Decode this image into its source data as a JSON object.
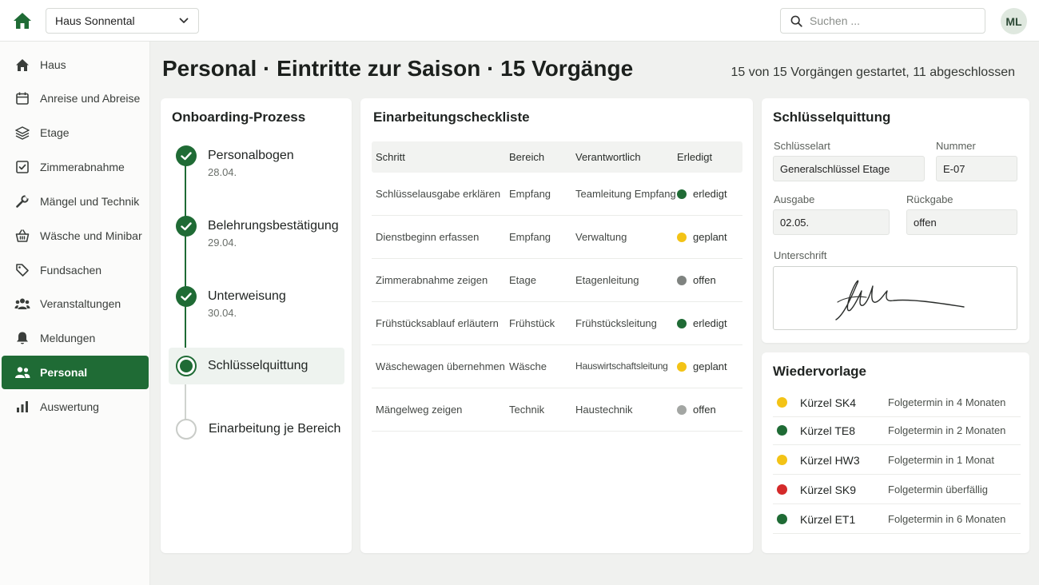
{
  "topbar": {
    "house": "Haus Sonnental",
    "search_placeholder": "Suchen ...",
    "avatar": "ML"
  },
  "sidebar": {
    "items": [
      {
        "label": "Haus",
        "icon": "home-icon"
      },
      {
        "label": "Anreise und Abreise",
        "icon": "calendar-icon"
      },
      {
        "label": "Etage",
        "icon": "layers-icon"
      },
      {
        "label": "Zimmerabnahme",
        "icon": "checkbox-icon"
      },
      {
        "label": "Mängel und Technik",
        "icon": "wrench-icon"
      },
      {
        "label": "Wäsche und Minibar",
        "icon": "basket-icon"
      },
      {
        "label": "Fundsachen",
        "icon": "tag-icon"
      },
      {
        "label": "Veranstaltungen",
        "icon": "group-icon"
      },
      {
        "label": "Meldungen",
        "icon": "bell-icon"
      },
      {
        "label": "Personal",
        "icon": "people-icon",
        "active": true
      },
      {
        "label": "Auswertung",
        "icon": "bar-chart-icon"
      }
    ]
  },
  "header": {
    "title": "Personal · Eintritte zur Saison · 15 Vorgänge",
    "summary": "15 von 15 Vorgängen gestartet, 11 abgeschlossen"
  },
  "onboarding": {
    "title": "Onboarding-Prozess",
    "steps": [
      {
        "label": "Personalbogen",
        "date": "28.04.",
        "state": "done"
      },
      {
        "label": "Belehrungsbestätigung",
        "date": "29.04.",
        "state": "done"
      },
      {
        "label": "Unterweisung",
        "date": "30.04.",
        "state": "done"
      },
      {
        "label": "Schlüsselquittung",
        "date": "",
        "state": "current"
      },
      {
        "label": "Einarbeitung je Bereich",
        "date": "",
        "state": "todo"
      }
    ]
  },
  "checklist": {
    "title": "Einarbeitungscheckliste",
    "columns": [
      "Schritt",
      "Bereich",
      "Verantwortlich",
      "Erledigt"
    ],
    "rows": [
      {
        "step": "Schlüsselausgabe erklären",
        "area": "Empfang",
        "responsible": "Teamleitung Empfang",
        "status": "erledigt",
        "color": "#1f6b35"
      },
      {
        "step": "Dienstbeginn erfassen",
        "area": "Empfang",
        "responsible": "Verwaltung",
        "status": "geplant",
        "color": "#f3c316"
      },
      {
        "step": "Zimmerabnahme zeigen",
        "area": "Etage",
        "responsible": "Etagenleitung",
        "status": "offen",
        "color": "#7f8380"
      },
      {
        "step": "Frühstücksablauf erläutern",
        "area": "Frühstück",
        "responsible": "Frühstücksleitung",
        "status": "erledigt",
        "color": "#1f6b35"
      },
      {
        "step": "Wäschewagen übernehmen",
        "area": "Wäsche",
        "responsible": "Hauswirtschaftsleitung",
        "status": "geplant",
        "color": "#f3c316"
      },
      {
        "step": "Mängelweg zeigen",
        "area": "Technik",
        "responsible": "Haustechnik",
        "status": "offen",
        "color": "#a3a6a3"
      }
    ]
  },
  "key_receipt": {
    "title": "Schlüsselquittung",
    "key_type_label": "Schlüsselart",
    "key_type": "Generalschlüssel Etage",
    "number_label": "Nummer",
    "number": "E-07",
    "issue_label": "Ausgabe",
    "issue": "02.05.",
    "return_label": "Rückgabe",
    "return": "offen",
    "signature_label": "Unterschrift"
  },
  "followup": {
    "title": "Wiedervorlage",
    "rows": [
      {
        "code": "Kürzel SK4",
        "text": "Folgetermin in 4 Monaten",
        "color": "#f3c316"
      },
      {
        "code": "Kürzel TE8",
        "text": "Folgetermin in 2 Monaten",
        "color": "#1f6b35"
      },
      {
        "code": "Kürzel HW3",
        "text": "Folgetermin in 1 Monat",
        "color": "#f3c316"
      },
      {
        "code": "Kürzel SK9",
        "text": "Folgetermin überfällig",
        "color": "#d42a2a"
      },
      {
        "code": "Kürzel ET1",
        "text": "Folgetermin in 6 Monaten",
        "color": "#1f6b35"
      }
    ]
  },
  "colors": {
    "accent": "#1f6b35"
  }
}
